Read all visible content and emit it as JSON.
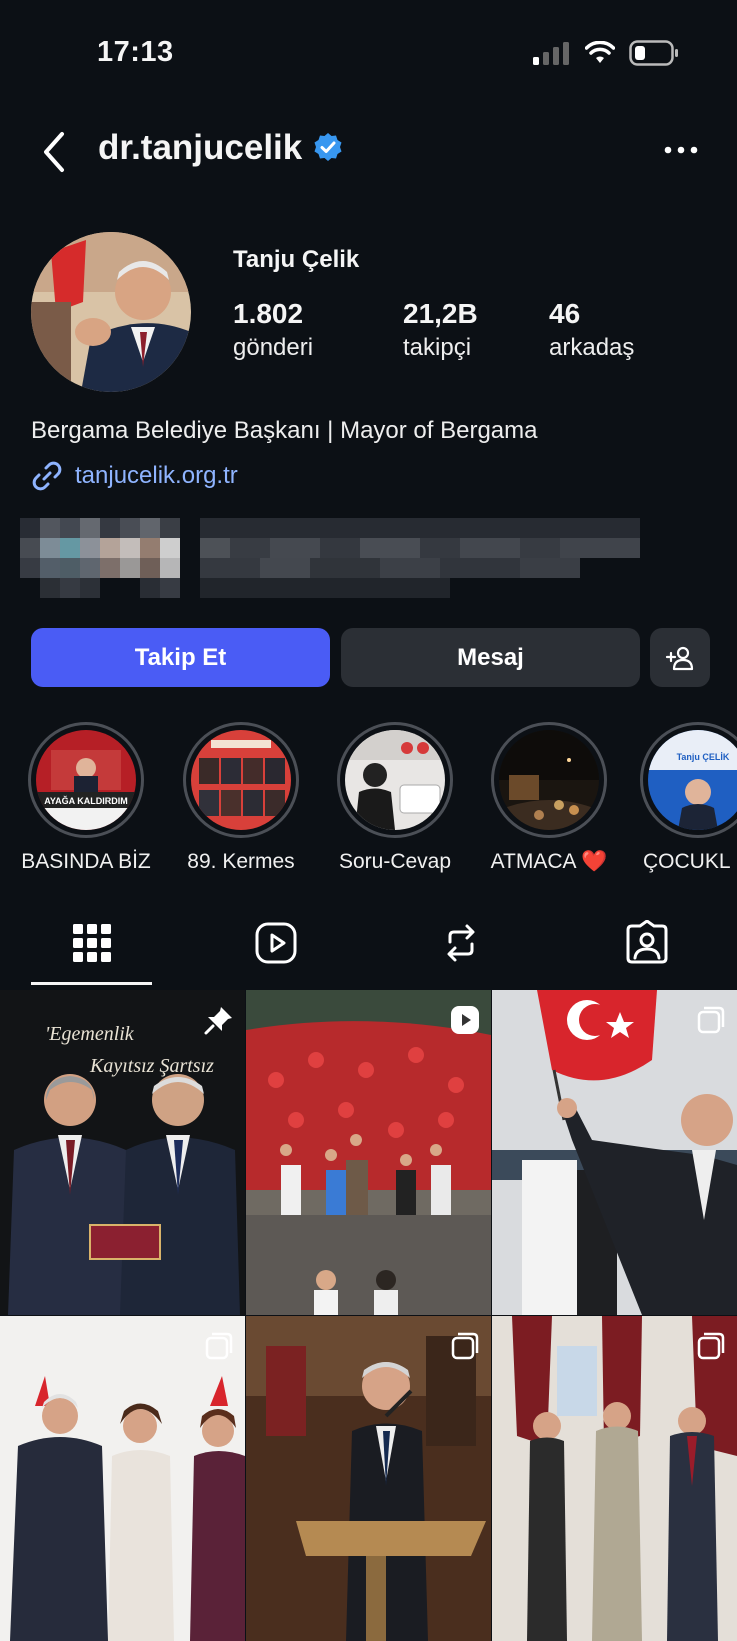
{
  "status_bar": {
    "time": "17:13"
  },
  "header": {
    "username": "dr.tanjucelik"
  },
  "profile": {
    "display_name": "Tanju Çelik",
    "stats": [
      {
        "value": "1.802",
        "label": "gönderi"
      },
      {
        "value": "21,2B",
        "label": "takipçi"
      },
      {
        "value": "46",
        "label": "arkadaş"
      }
    ],
    "bio": "Bergama Belediye Başkanı | Mayor of Bergama",
    "link": "tanjucelik.org.tr"
  },
  "actions": {
    "follow_label": "Takip Et",
    "message_label": "Mesaj"
  },
  "highlights": [
    {
      "label": "BASINDA BİZ",
      "banner": "AYAĞA KALDIRDIM"
    },
    {
      "label": "89. Kermes"
    },
    {
      "label": "Soru-Cevap"
    },
    {
      "label": "ATMACA ❤️"
    },
    {
      "label": "ÇOCUKL",
      "banner": "Tanju ÇELİK"
    }
  ],
  "posts": [
    {
      "caption_line1": "'Egemenlik",
      "caption_line2": "Kayıtsız Şartsız",
      "badge": "pinned"
    },
    {
      "badge": "reel"
    },
    {
      "badge": "carousel"
    },
    {
      "badge": "carousel"
    },
    {
      "badge": "carousel"
    },
    {
      "badge": "carousel"
    }
  ],
  "colors": {
    "background": "#0c1015",
    "follow_button": "#4a5cf5",
    "secondary_button": "#2b2f35",
    "link": "#8fb4ff",
    "verified": "#3897f0"
  }
}
